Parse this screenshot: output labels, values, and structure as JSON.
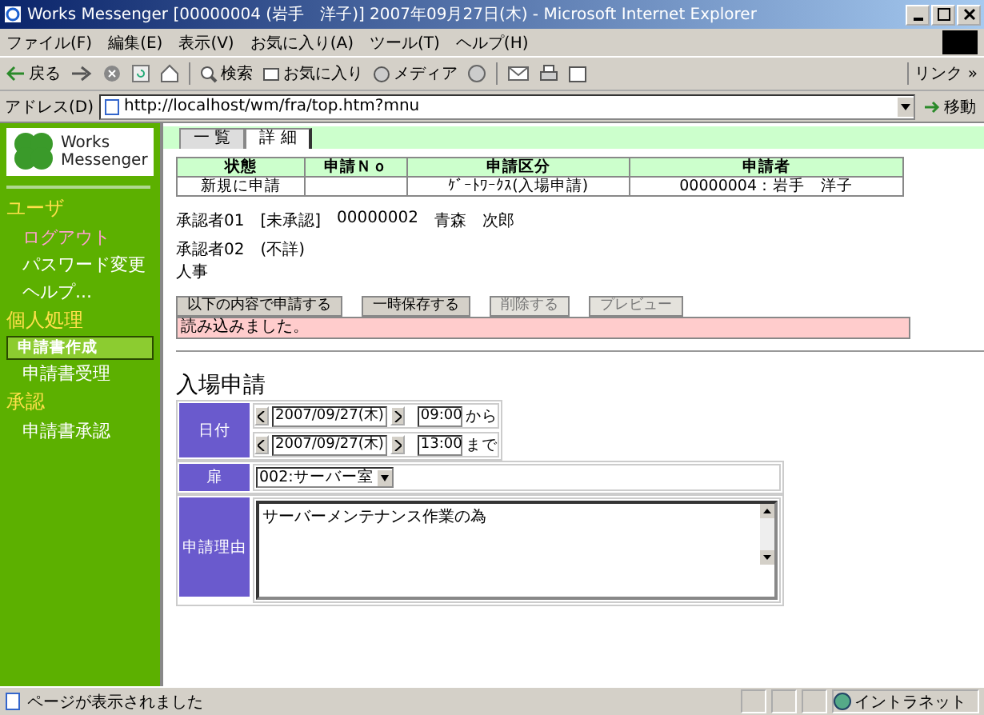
{
  "window": {
    "title": "Works Messenger [00000004 (岩手　洋子)] 2007年09月27日(木) - Microsoft Internet Explorer"
  },
  "menu": [
    "ファイル(F)",
    "編集(E)",
    "表示(V)",
    "お気に入り(A)",
    "ツール(T)",
    "ヘルプ(H)"
  ],
  "toolbar": {
    "back": "戻る",
    "search": "検索",
    "favorites": "お気に入り",
    "media": "メディア",
    "links": "リンク »"
  },
  "address": {
    "label": "アドレス(D)",
    "url": "http://localhost/wm/fra/top.htm?mnu",
    "go": "移動"
  },
  "logo": {
    "line1": "Works",
    "line2": "Messenger"
  },
  "sidebar": [
    {
      "title": "ユーザ",
      "items": [
        {
          "label": "ログアウト",
          "kind": "accent",
          "selected": false
        },
        {
          "label": "パスワード変更",
          "kind": "plain",
          "selected": false
        },
        {
          "label": "ヘルプ...",
          "kind": "plain",
          "selected": false
        }
      ]
    },
    {
      "title": "個人処理",
      "items": [
        {
          "label": "申請書作成",
          "kind": "plain",
          "selected": true
        },
        {
          "label": "申請書受理",
          "kind": "plain",
          "selected": false
        }
      ]
    },
    {
      "title": "承認",
      "items": [
        {
          "label": "申請書承認",
          "kind": "plain",
          "selected": false
        }
      ]
    }
  ],
  "tabs": [
    {
      "label": "一 覧",
      "selected": false
    },
    {
      "label": "詳 細",
      "selected": true
    }
  ],
  "summary": {
    "columns": [
      "状態",
      "申請Ｎｏ",
      "申請区分",
      "申請者"
    ],
    "row": {
      "status": "新規に申請",
      "category": "ｹﾞｰﾄﾜｰｸｽ(入場申請)",
      "applicant": "00000004：岩手　洋子"
    }
  },
  "approvers": [
    {
      "label": "承認者01",
      "status": "[未承認]",
      "id": "00000002",
      "name": "青森　次郎"
    },
    {
      "label": "承認者02",
      "status": "(不詳)",
      "note": "人事"
    }
  ],
  "buttons": [
    {
      "label": "以下の内容で申請する",
      "disabled": false
    },
    {
      "label": "一時保存する",
      "disabled": false
    },
    {
      "label": "削除する",
      "disabled": true
    },
    {
      "label": "プレビュー",
      "disabled": true
    }
  ],
  "message": "読み込みました。",
  "form": {
    "title": "入場申請",
    "date": {
      "label": "日付",
      "ranges": [
        {
          "date": "2007/09/27(木)",
          "time": "09:00",
          "suffix": "から"
        },
        {
          "date": "2007/09/27(木)",
          "time": "13:00",
          "suffix": "まで"
        }
      ]
    },
    "door": {
      "label": "扉",
      "value": "002:サーバー室"
    },
    "reason": {
      "label": "申請理由",
      "value": "サーバーメンテナンス作業の為"
    }
  },
  "status_bar": {
    "text": "ページが表示されました",
    "zone": "イントラネット"
  }
}
